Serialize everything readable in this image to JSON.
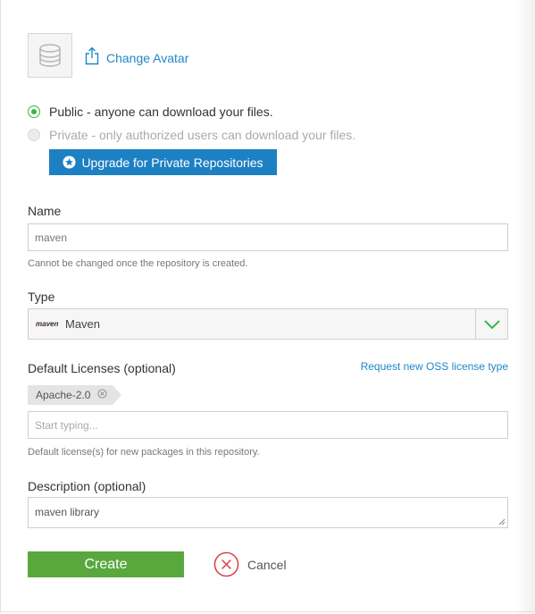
{
  "avatar": {
    "change_label": "Change Avatar"
  },
  "visibility": {
    "public_label": "Public - anyone can download your files.",
    "private_label": "Private - only authorized users can download your files.",
    "upgrade_label": "Upgrade for Private Repositories",
    "selected": "public"
  },
  "name": {
    "label": "Name",
    "value": "maven",
    "help": "Cannot be changed once the repository is created."
  },
  "type": {
    "label": "Type",
    "logo_text": "maven",
    "value": "Maven"
  },
  "licenses": {
    "label": "Default Licenses (optional)",
    "request_link": "Request new OSS license type",
    "tags": [
      "Apache-2.0"
    ],
    "placeholder": "Start typing...",
    "help": "Default license(s) for new packages in this repository."
  },
  "description": {
    "label": "Description (optional)",
    "value": "maven library"
  },
  "actions": {
    "create_label": "Create",
    "cancel_label": "Cancel"
  },
  "colors": {
    "accent_blue": "#1d80c3",
    "create_green": "#58a83d",
    "radio_green": "#3bb54a",
    "cancel_red": "#d9393c"
  }
}
